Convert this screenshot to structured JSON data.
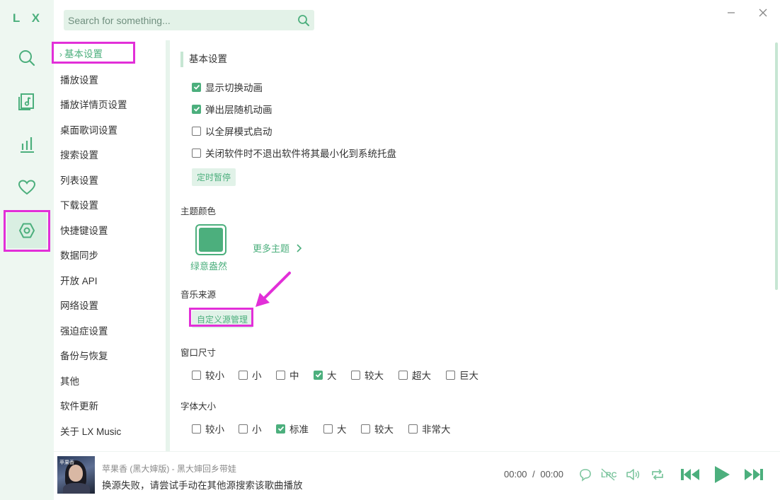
{
  "app": {
    "logo": "L X"
  },
  "search": {
    "placeholder": "Search for something..."
  },
  "rail": {
    "items": [
      {
        "icon": "search-icon"
      },
      {
        "icon": "music-library-icon"
      },
      {
        "icon": "leaderboard-icon"
      },
      {
        "icon": "heart-icon"
      },
      {
        "icon": "settings-icon",
        "active": true
      }
    ]
  },
  "sidebar": {
    "items": [
      {
        "label": "基本设置",
        "active": true
      },
      {
        "label": "播放设置"
      },
      {
        "label": "播放详情页设置"
      },
      {
        "label": "桌面歌词设置"
      },
      {
        "label": "搜索设置"
      },
      {
        "label": "列表设置"
      },
      {
        "label": "下载设置"
      },
      {
        "label": "快捷键设置"
      },
      {
        "label": "数据同步"
      },
      {
        "label": "开放 API"
      },
      {
        "label": "网络设置"
      },
      {
        "label": "强迫症设置"
      },
      {
        "label": "备份与恢复"
      },
      {
        "label": "其他"
      },
      {
        "label": "软件更新"
      },
      {
        "label": "关于 LX Music"
      }
    ]
  },
  "basic": {
    "title": "基本设置",
    "options": [
      {
        "label": "显示切换动画",
        "checked": true
      },
      {
        "label": "弹出层随机动画",
        "checked": true
      },
      {
        "label": "以全屏模式启动",
        "checked": false
      },
      {
        "label": "关闭软件时不退出软件将其最小化到系统托盘",
        "checked": false
      }
    ],
    "timer_button": "定时暂停"
  },
  "theme": {
    "label": "主题颜色",
    "current_name": "绿意盎然",
    "current_color": "#4caf7d",
    "more_label": "更多主题"
  },
  "source": {
    "label": "音乐来源",
    "custom_button": "自定义源管理"
  },
  "window_size": {
    "label": "窗口尺寸",
    "options": [
      {
        "label": "较小",
        "checked": false
      },
      {
        "label": "小",
        "checked": false
      },
      {
        "label": "中",
        "checked": false
      },
      {
        "label": "大",
        "checked": true
      },
      {
        "label": "较大",
        "checked": false
      },
      {
        "label": "超大",
        "checked": false
      },
      {
        "label": "巨大",
        "checked": false
      }
    ]
  },
  "font_size": {
    "label": "字体大小",
    "options": [
      {
        "label": "较小",
        "checked": false
      },
      {
        "label": "小",
        "checked": false
      },
      {
        "label": "标准",
        "checked": true
      },
      {
        "label": "大",
        "checked": false
      },
      {
        "label": "较大",
        "checked": false
      },
      {
        "label": "非常大",
        "checked": false
      }
    ]
  },
  "player": {
    "song_title": "苹果香 (黑大婶版) - 黑大婶回乡带娃",
    "status": "换源失败，请尝试手动在其他源搜索该歌曲播放",
    "current_time": "00:00",
    "separator": "/",
    "total_time": "00:00",
    "cover_text": "苹果香"
  },
  "colors": {
    "accent": "#4caf7d",
    "highlight": "#e22fd8"
  }
}
